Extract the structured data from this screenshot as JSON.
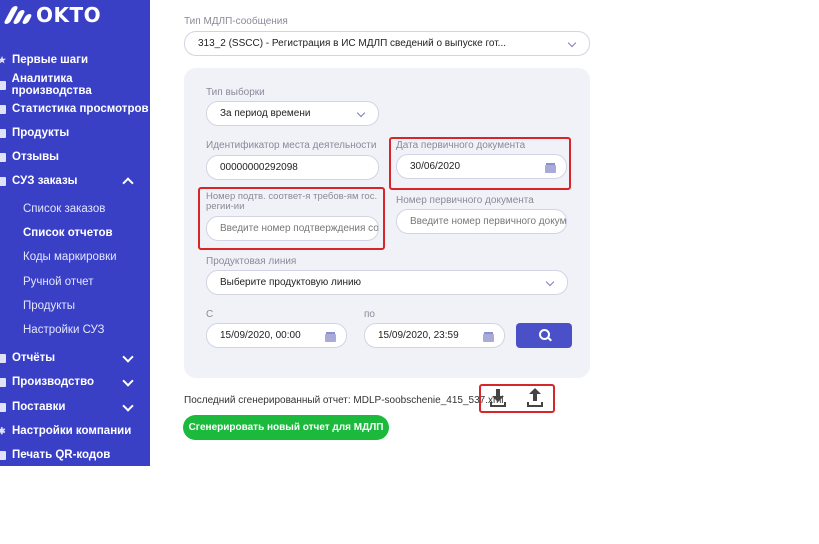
{
  "brand": {
    "logo_text": "OKTO"
  },
  "sidebar": {
    "items": [
      {
        "label": "Первые шаги"
      },
      {
        "label": "Аналитика производства"
      },
      {
        "label": "Статистика просмотров"
      },
      {
        "label": "Продукты"
      },
      {
        "label": "Отзывы"
      },
      {
        "label": "СУЗ заказы"
      },
      {
        "label": "Отчёты"
      },
      {
        "label": "Производство"
      },
      {
        "label": "Поставки"
      },
      {
        "label": "Настройки компании"
      },
      {
        "label": "Печать QR-кодов"
      }
    ],
    "suz_sub": [
      {
        "label": "Список заказов"
      },
      {
        "label": "Список отчетов"
      },
      {
        "label": "Коды маркировки"
      },
      {
        "label": "Ручной отчет"
      },
      {
        "label": "Продукты"
      },
      {
        "label": "Настройки СУЗ"
      }
    ]
  },
  "form": {
    "message_type_label": "Тип МДЛП-сообщения",
    "message_type_value": "313_2 (SSCC) - Регистрация в ИС МДЛП сведений о выпуске гот...",
    "sample_type_label": "Тип выборки",
    "sample_type_value": "За период времени",
    "place_id_label": "Идентификатор места деятельности",
    "place_id_value": "00000000292098",
    "primary_doc_date_label": "Дата первичного документа",
    "primary_doc_date_value": "30/06/2020",
    "confirmation_label": "Номер подтв. соответ-я требов-ям гос. регии-ии",
    "confirmation_placeholder": "Введите номер подтверждения со",
    "primary_doc_number_label": "Номер первичного документа",
    "primary_doc_number_placeholder": "Введите номер первичного докум",
    "product_line_label": "Продуктовая линия",
    "product_line_placeholder": "Выберите продуктовую линию",
    "from_label": "С",
    "from_value": "15/09/2020, 00:00",
    "to_label": "по",
    "to_value": "15/09/2020, 23:59"
  },
  "last_report": {
    "text": "Последний сгенерированный отчет: MDLP-soobschenie_415_537.xml"
  },
  "generate_button": {
    "label": "Сгенерировать новый отчет для МДЛП"
  },
  "colors": {
    "sidebar": "#3a40c6",
    "accent": "#4a50c8",
    "green": "#1bb93c",
    "highlight": "#d7262a",
    "panel": "#f1f2f8"
  }
}
